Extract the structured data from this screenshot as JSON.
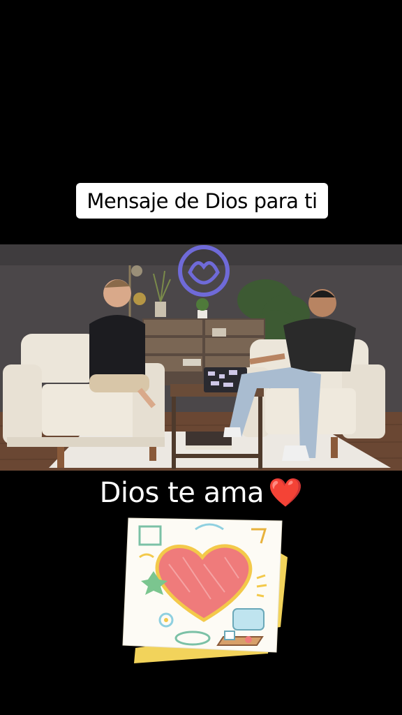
{
  "header": {
    "title": "Mensaje de Dios para ti"
  },
  "caption": {
    "text": "Dios te ama",
    "emoji": "❤️"
  },
  "scene": {
    "wall_color": "#4a4648",
    "floor_color": "#6b4a36",
    "logo_color": "#6f6ad8"
  },
  "sticker": {
    "heart_color": "#ef7b7b",
    "card_back_color": "#f2d35b",
    "icon_name": "doodle-heart-sticker"
  }
}
